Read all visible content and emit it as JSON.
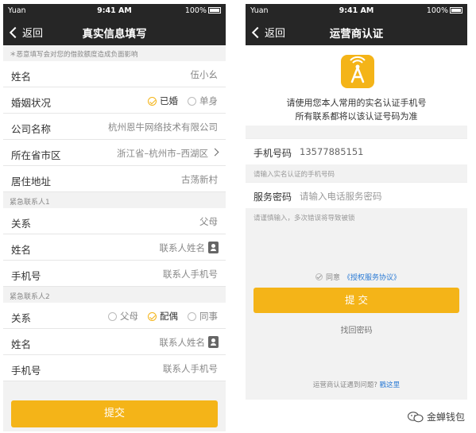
{
  "left": {
    "status": {
      "carrier": "Yuan",
      "time": "9:41 AM",
      "battery": "100%"
    },
    "nav": {
      "back": "返回",
      "title": "真实信息填写"
    },
    "notice": "＊恶意填写会对您的借款额度造成负面影响",
    "fields": {
      "name": {
        "label": "姓名",
        "value": "伍小幺"
      },
      "marital": {
        "label": "婚姻状况",
        "options": [
          "已婚",
          "单身"
        ],
        "selected": "已婚"
      },
      "company": {
        "label": "公司名称",
        "value": "杭州恩牛网络技术有限公司"
      },
      "region": {
        "label": "所在省市区",
        "value": "浙江省–杭州市–西湖区"
      },
      "address": {
        "label": "居住地址",
        "value": "古荡新村"
      }
    },
    "contact1": {
      "header": "紧急联系人1",
      "relation": {
        "label": "关系",
        "value": "父母"
      },
      "name": {
        "label": "姓名",
        "placeholder": "联系人姓名"
      },
      "phone": {
        "label": "手机号",
        "placeholder": "联系人手机号"
      }
    },
    "contact2": {
      "header": "紧急联系人2",
      "relation": {
        "label": "关系",
        "options": [
          "父母",
          "配偶",
          "同事"
        ],
        "selected": "配偶"
      },
      "name": {
        "label": "姓名",
        "placeholder": "联系人姓名"
      },
      "phone": {
        "label": "手机号",
        "placeholder": "联系人手机号"
      }
    },
    "submit": "提交"
  },
  "right": {
    "status": {
      "carrier": "Yuan",
      "time": "9:41 AM",
      "battery": "100%"
    },
    "nav": {
      "back": "返回",
      "title": "运营商认证"
    },
    "icon": "signal-tower-icon",
    "intro_line1": "请使用您本人常用的实名认证手机号",
    "intro_line2": "所有联系都将以该认证号码为准",
    "phone": {
      "label": "手机号码",
      "value": "13577885151"
    },
    "phone_hint": "请输入实名认证的手机号码",
    "password": {
      "label": "服务密码",
      "placeholder": "请输入电话服务密码"
    },
    "password_hint": "请谨慎输入，多次错误将导致被锁",
    "agree_text": "同意",
    "agree_link": "《授权服务协议》",
    "submit": "提 交",
    "forgot": "找回密码",
    "problem_text": "运营商认证遇到问题?",
    "problem_link": "戳这里"
  },
  "watermark": "金蝉钱包",
  "colors": {
    "accent": "#f4b418",
    "navbar": "#262626",
    "link": "#2a7ad4"
  }
}
